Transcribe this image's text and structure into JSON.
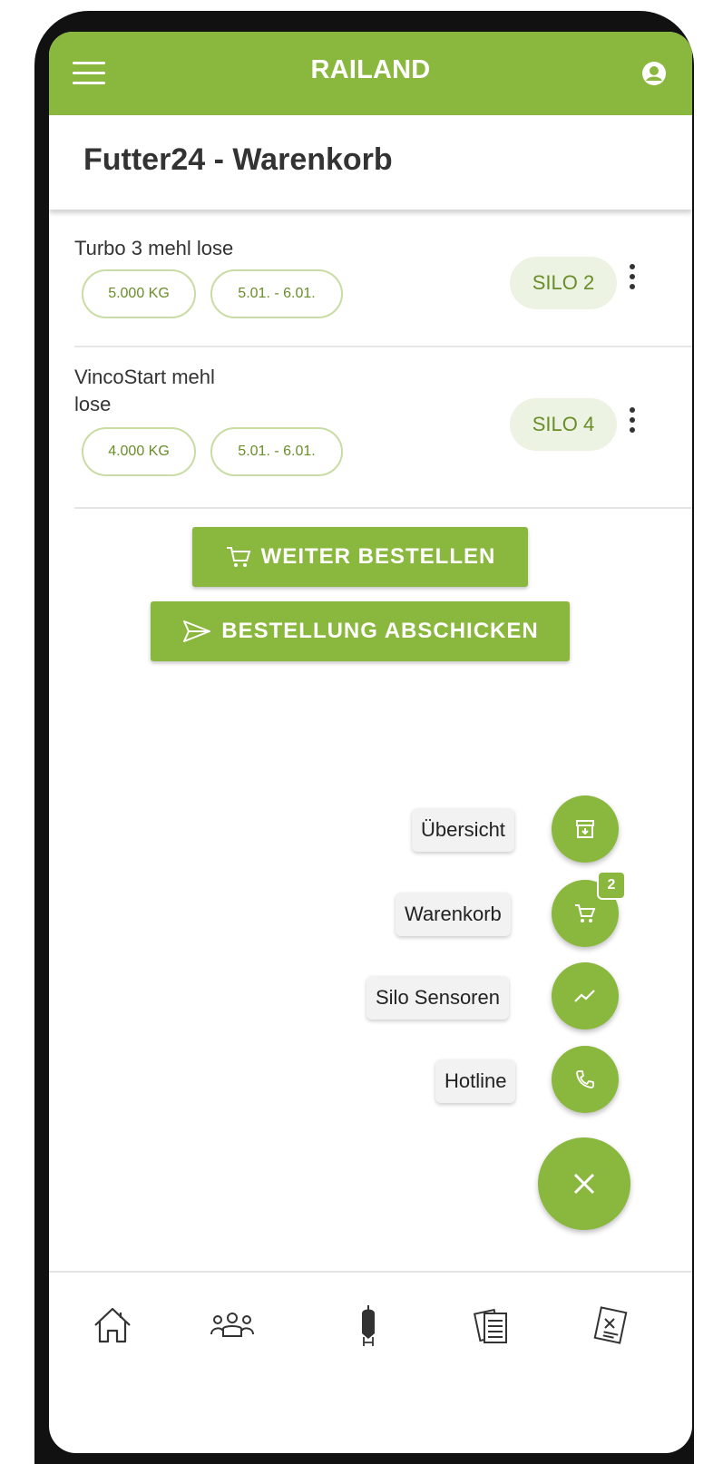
{
  "appbar": {
    "title": "RAILAND",
    "menu_icon": "hamburger-menu-icon",
    "account_icon": "account-circle-icon"
  },
  "page": {
    "title": "Futter24 - Warenkorb"
  },
  "cart_items": [
    {
      "name": "Turbo 3 mehl lose",
      "quantity": "5.000 KG",
      "date_range": "5.01. - 6.01.",
      "silo": "SILO 2"
    },
    {
      "name": "VincoStart mehl lose",
      "quantity": "4.000 KG",
      "date_range": "5.01. - 6.01.",
      "silo": "SILO 4"
    }
  ],
  "actions": {
    "continue_label": "WEITER BESTELLEN",
    "submit_label": "BESTELLUNG ABSCHICKEN"
  },
  "speed_dial": {
    "items": [
      {
        "label": "Übersicht",
        "icon": "archive-icon"
      },
      {
        "label": "Warenkorb",
        "icon": "cart-icon",
        "badge": "2"
      },
      {
        "label": "Silo Sensoren",
        "icon": "trend-chart-icon"
      },
      {
        "label": "Hotline",
        "icon": "phone-icon"
      }
    ],
    "close_icon": "close-icon"
  },
  "bottom_nav": [
    {
      "icon": "home-icon"
    },
    {
      "icon": "users-group-icon"
    },
    {
      "icon": "silo-icon"
    },
    {
      "icon": "documents-icon"
    },
    {
      "icon": "invoice-icon"
    }
  ],
  "colors": {
    "primary": "#8ab73d",
    "chip_border": "#c8dca4",
    "silo_bg": "#ecf3e2"
  }
}
